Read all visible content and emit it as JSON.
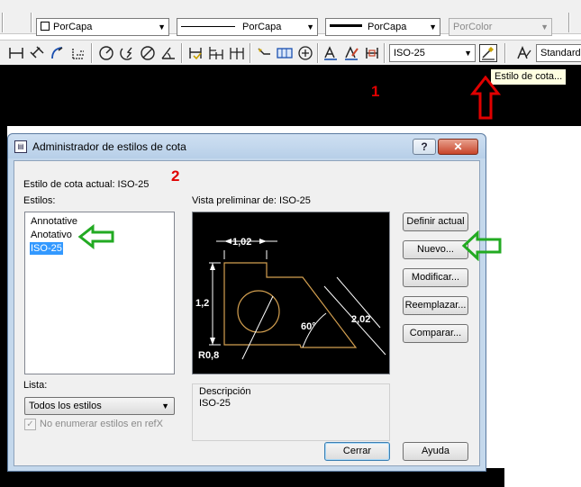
{
  "toolbar_top": {
    "layer_color_combo": "PorCapa",
    "linetype_combo": "PorCapa",
    "lineweight_combo": "PorCapa",
    "plotstyle_combo": "PorColor"
  },
  "toolbar_dim": {
    "dimstyle_combo": "ISO-25",
    "textstyle_combo": "Standard"
  },
  "tooltip": "Estilo de cota...",
  "annotations": {
    "label_1": "1",
    "label_2": "2"
  },
  "dialog": {
    "title": "Administrador de estilos de cota",
    "help_button": "?",
    "current_style": "Estilo de cota actual: ISO-25",
    "styles_label": "Estilos:",
    "styles": [
      {
        "label": "Annotative",
        "selected": false
      },
      {
        "label": "Anotativo",
        "selected": false
      },
      {
        "label": "ISO-25",
        "selected": true
      }
    ],
    "preview_label": "Vista preliminar de: ISO-25",
    "preview_dims": {
      "top": "1,02",
      "left": "1,2",
      "right": "2,02",
      "angle": "60°",
      "radius": "R0,8"
    },
    "description_label": "Descripción",
    "description_value": "ISO-25",
    "list_label": "Lista:",
    "list_value": "Todos los estilos",
    "checkbox_label": "No enumerar estilos en refX",
    "buttons": {
      "set_current": "Definir actual",
      "new": "Nuevo...",
      "modify": "Modificar...",
      "override": "Reemplazar...",
      "compare": "Comparar...",
      "close": "Cerrar",
      "help": "Ayuda"
    }
  },
  "colors": {
    "annotation_red": "#e00000",
    "annotation_green": "#22aa22",
    "selection_blue": "#3399ff",
    "preview_geometry": "#d4a050"
  }
}
